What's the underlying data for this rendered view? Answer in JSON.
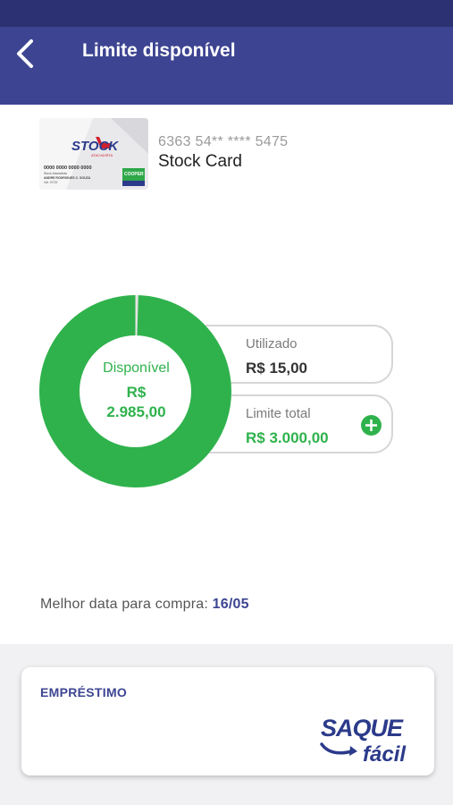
{
  "header": {
    "title": "Limite disponível",
    "back_icon": "chevron-left-icon"
  },
  "card": {
    "number": "6363 54** **** 5475",
    "name": "Stock Card",
    "image": {
      "brand": "STOCK",
      "sub_brand": "ATACADISTA",
      "number": "0000 0000 0000 0000",
      "issuer": "Stock Atacadista",
      "holder": "ANDRE RODRIGUES C. SOUZA",
      "valid": "Val. 07/22",
      "partner": "COOPER"
    }
  },
  "limit": {
    "available_label": "Disponível",
    "available_currency": "R$",
    "available_value": "2.985,00",
    "used_label": "Utilizado",
    "used_value": "R$ 15,00",
    "total_label": "Limite total",
    "total_value": "R$ 3.000,00",
    "used_fraction": 0.005,
    "add_icon": "plus-circle-icon"
  },
  "best_date": {
    "label": "Melhor data para compra:",
    "value": "16/05"
  },
  "loan": {
    "title": "EMPRÉSTIMO",
    "logo_top": "SAQUE",
    "logo_bottom": "fácil"
  },
  "colors": {
    "primary": "#3d4592",
    "status_bar": "#2b3172",
    "green": "#2fb24c",
    "card_red": "#d0202f"
  }
}
